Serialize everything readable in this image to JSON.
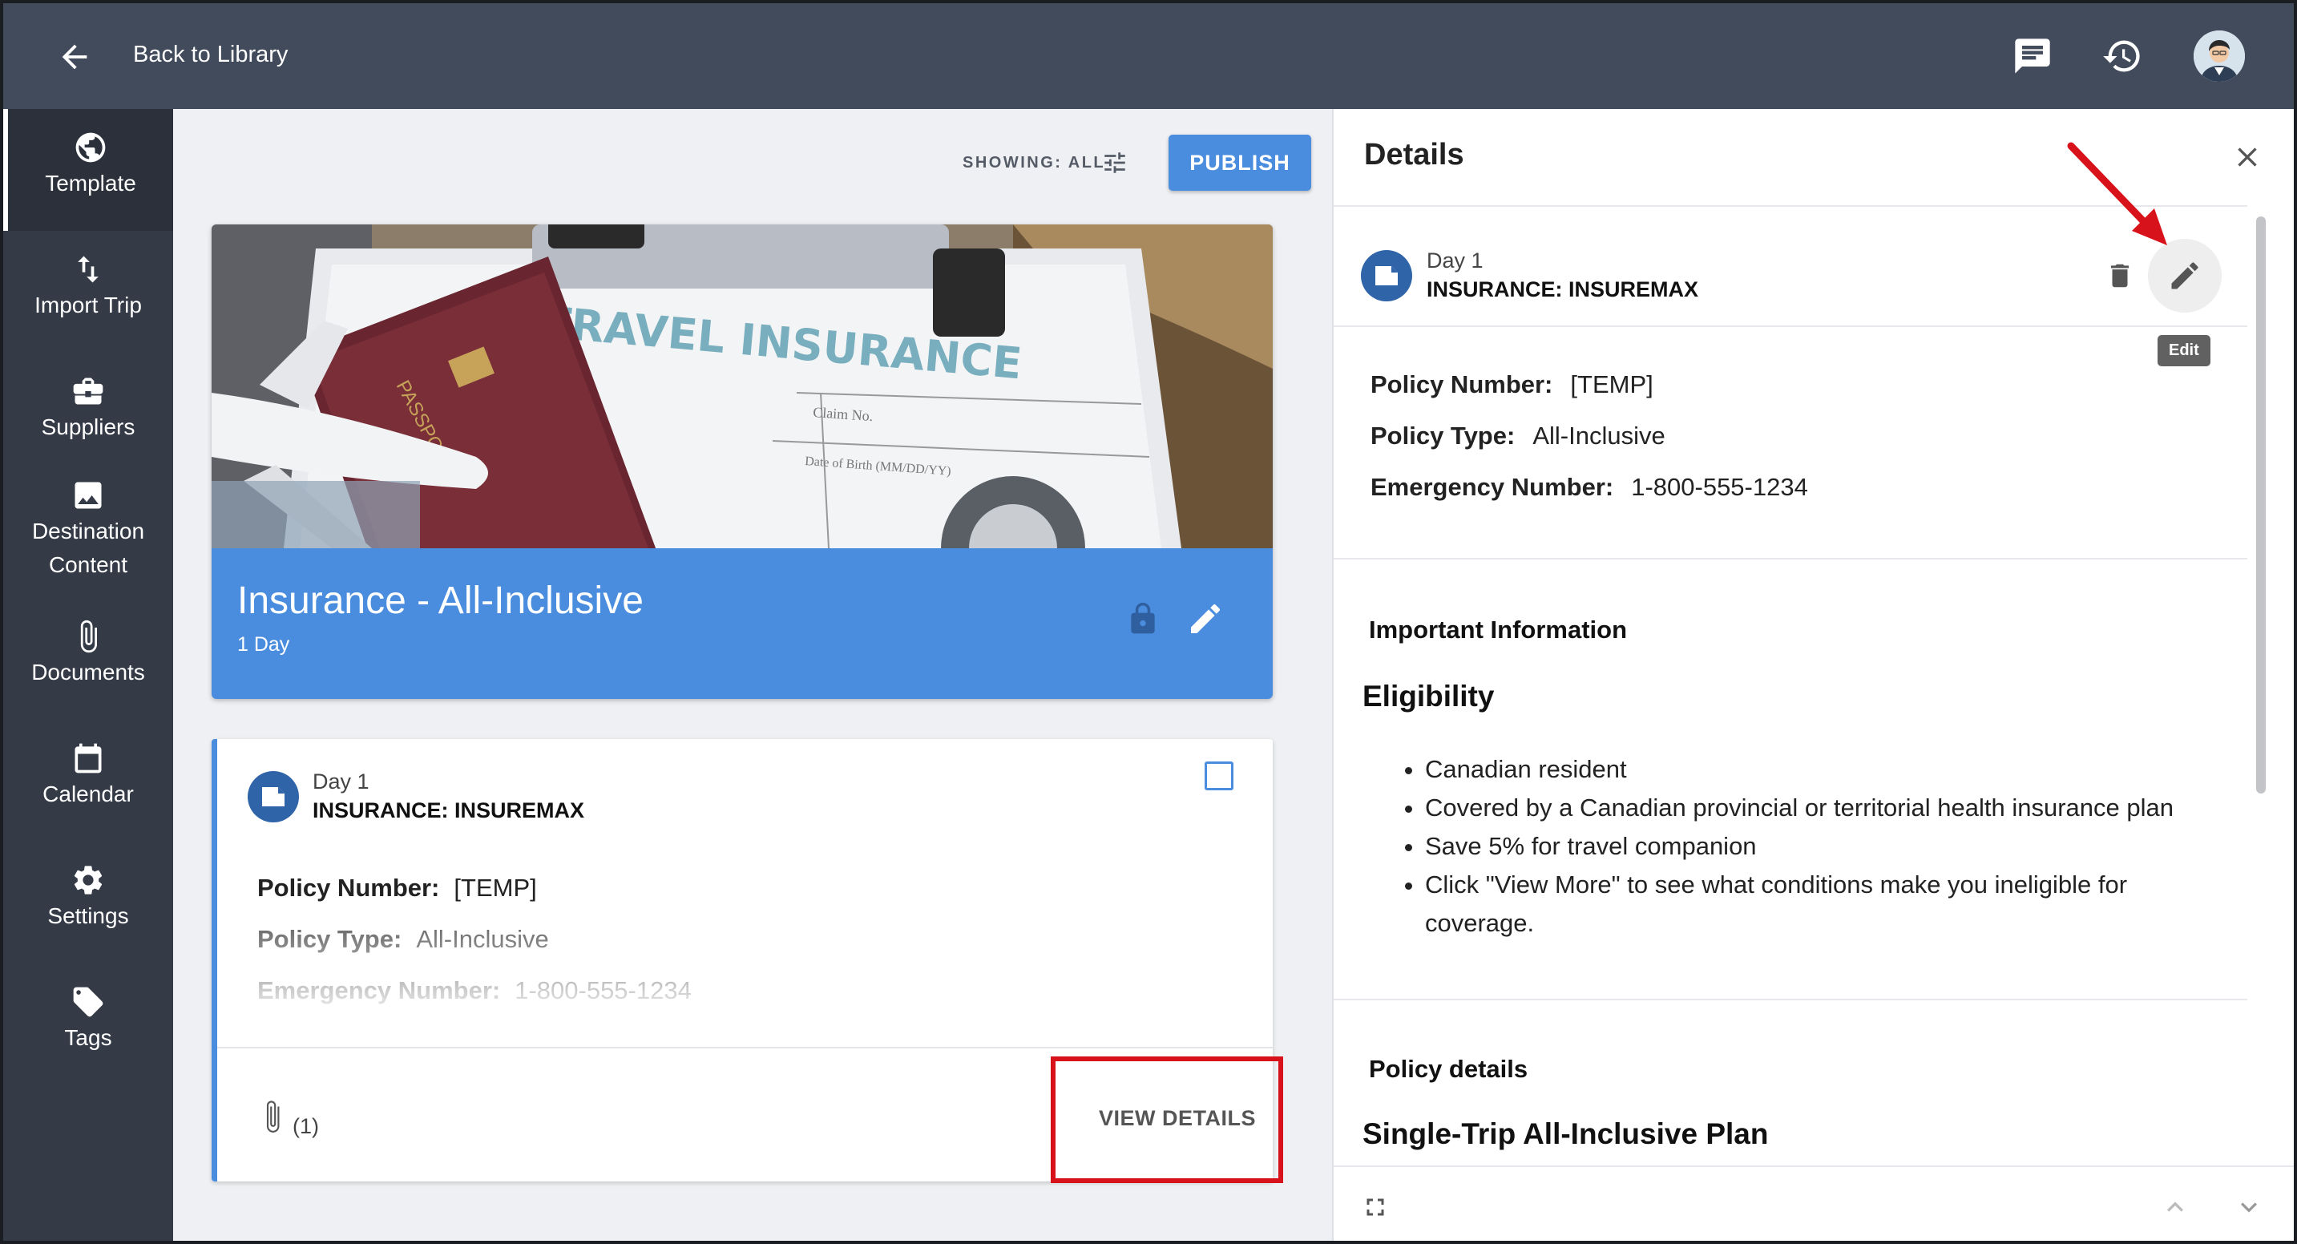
{
  "topbar": {
    "back_label": "Back to Library",
    "icons": [
      "back-arrow-icon",
      "chat-icon",
      "history-icon",
      "avatar"
    ]
  },
  "sidebar": {
    "items": [
      {
        "label": "Template",
        "icon": "globe-icon",
        "active": true
      },
      {
        "label": "Import Trip",
        "icon": "import-arrows-icon"
      },
      {
        "label": "Suppliers",
        "icon": "briefcase-icon"
      },
      {
        "label": "Destination Content",
        "icon": "image-icon"
      },
      {
        "label": "Documents",
        "icon": "paperclip-icon"
      },
      {
        "label": "Calendar",
        "icon": "calendar-icon"
      },
      {
        "label": "Settings",
        "icon": "gear-icon"
      },
      {
        "label": "Tags",
        "icon": "tag-icon"
      }
    ]
  },
  "toolbar": {
    "showing_label": "SHOWING: ALL",
    "publish_label": "PUBLISH"
  },
  "hero": {
    "image_text": "TRAVEL INSURANCE",
    "title": "Insurance - All-Inclusive",
    "subtitle": "1 Day"
  },
  "card": {
    "day": "Day 1",
    "name": "INSURANCE: INSUREMAX",
    "fields": [
      {
        "key": "Policy Number:",
        "value": "[TEMP]"
      },
      {
        "key": "Policy Type:",
        "value": "All-Inclusive"
      },
      {
        "key": "Emergency Number:",
        "value": "1-800-555-1234"
      }
    ],
    "attachment_count": "(1)",
    "view_details_label": "VIEW DETAILS"
  },
  "details": {
    "title": "Details",
    "day": "Day 1",
    "name": "INSURANCE: INSUREMAX",
    "tooltip": "Edit",
    "fields": [
      {
        "key": "Policy Number:",
        "value": "[TEMP]"
      },
      {
        "key": "Policy Type:",
        "value": "All-Inclusive"
      },
      {
        "key": "Emergency Number:",
        "value": "1-800-555-1234"
      }
    ],
    "important_title": "Important Information",
    "eligibility_title": "Eligibility",
    "bullets": [
      "Canadian resident",
      "Covered by a Canadian provincial or territorial health insurance plan",
      "Save 5% for travel companion",
      "Click \"View More\" to see what conditions make you ineligible for coverage."
    ],
    "policy_title": "Policy details",
    "plan_title": "Single-Trip All-Inclusive Plan"
  },
  "colors": {
    "topbar": "#414b5c",
    "sidebar": "#343a46",
    "accent": "#4a8ddf",
    "highlight": "#d8121b"
  }
}
